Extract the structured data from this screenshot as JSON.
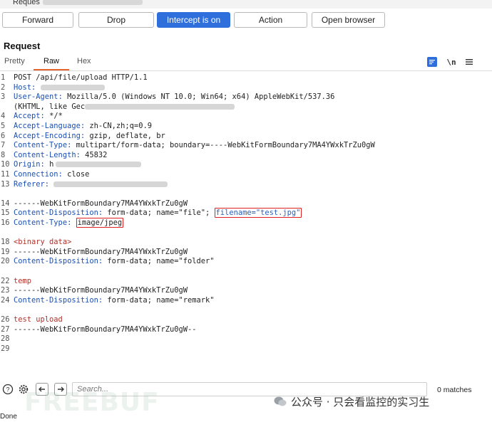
{
  "window": {
    "title_partial": "Reques"
  },
  "toolbar": {
    "forward": "Forward",
    "drop": "Drop",
    "intercept": "Intercept is on",
    "action": "Action",
    "open_browser": "Open browser",
    "accent_color": "#2f6fdb"
  },
  "request": {
    "title": "Request",
    "tabs": [
      "Pretty",
      "Raw",
      "Hex"
    ],
    "icons": {
      "newline": "\\n",
      "wrap": "wrap-icon",
      "menu": "menu-icon"
    }
  },
  "lines": [
    {
      "n": "1",
      "text": "POST /api/file/upload HTTP/1.1"
    },
    {
      "n": "2",
      "key": "Host",
      "val": ""
    },
    {
      "n": "3",
      "key": "User-Agent",
      "val": "Mozilla/5.0 (Windows NT 10.0; Win64; x64) AppleWebKit/537.36"
    },
    {
      "n": "",
      "text": "(KHTML, like Gec"
    },
    {
      "n": "4",
      "key": "Accept",
      "val": "*/*"
    },
    {
      "n": "5",
      "key": "Accept-Language",
      "val": "zh-CN,zh;q=0.9"
    },
    {
      "n": "6",
      "key": "Accept-Encoding",
      "val": "gzip, deflate, br"
    },
    {
      "n": "7",
      "key": "Content-Type",
      "val": "multipart/form-data; boundary=----WebKitFormBoundary7MA4YWxkTrZu0gW"
    },
    {
      "n": "8",
      "key": "Content-Length",
      "val": "45832"
    },
    {
      "n": "10",
      "key": "Origin",
      "val": "h"
    },
    {
      "n": "11",
      "key": "Connection",
      "val": "close"
    },
    {
      "n": "13",
      "key": "Referer",
      "val": ""
    },
    {
      "n": "",
      "text": ""
    },
    {
      "n": "14",
      "text": "------WebKitFormBoundary7MA4YWxkTrZu0gW"
    },
    {
      "n": "15",
      "key": "Content-Disposition",
      "val": "form-data; name=\"file\";",
      "hl": "filename=\"test.jpg\""
    },
    {
      "n": "16",
      "key": "Content-Type",
      "hl": "image/jpeg"
    },
    {
      "n": "",
      "text": ""
    },
    {
      "n": "18",
      "kw": "<binary data>"
    },
    {
      "n": "19",
      "text": "------WebKitFormBoundary7MA4YWxkTrZu0gW"
    },
    {
      "n": "20",
      "key": "Content-Disposition",
      "val": "form-data; name=\"folder\""
    },
    {
      "n": "",
      "text": ""
    },
    {
      "n": "22",
      "kw": "temp"
    },
    {
      "n": "23",
      "text": "------WebKitFormBoundary7MA4YWxkTrZu0gW"
    },
    {
      "n": "24",
      "key": "Content-Disposition",
      "val": "form-data; name=\"remark\""
    },
    {
      "n": "",
      "text": ""
    },
    {
      "n": "26",
      "kw": "test upload"
    },
    {
      "n": "27",
      "text": "------WebKitFormBoundary7MA4YWxkTrZu0gW--"
    },
    {
      "n": "28",
      "text": ""
    },
    {
      "n": "29",
      "text": ""
    }
  ],
  "search": {
    "placeholder": "Search...",
    "matches": "0 matches"
  },
  "status": {
    "done": "Done"
  },
  "watermark": {
    "freebuf": "FREEBUF",
    "wechat": "公众号 · 只会看监控的实习生"
  }
}
